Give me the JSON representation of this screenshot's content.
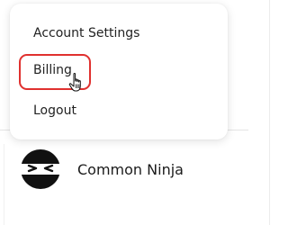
{
  "menu": {
    "items": [
      {
        "label": "Account Settings"
      },
      {
        "label": "Billing"
      },
      {
        "label": "Logout"
      }
    ],
    "highlighted_item": "Billing",
    "highlight_color": "#e0312f"
  },
  "profile": {
    "name": "Common Ninja",
    "avatar_icon": "ninja-icon"
  }
}
